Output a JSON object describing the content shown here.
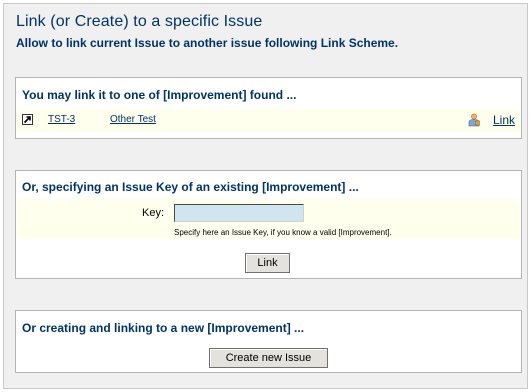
{
  "header": {
    "title": "Link (or Create) to a specific Issue",
    "subtitle": "Allow to link current Issue to another issue following Link Scheme."
  },
  "found_section": {
    "heading": "You may link it to one of [Improvement] found ...",
    "rows": [
      {
        "icon": "improvement-icon",
        "key": "TST-3",
        "summary": "Other Test",
        "assignee_icon": "person-icon",
        "action": "Link"
      }
    ]
  },
  "key_section": {
    "heading": "Or, specifying an Issue Key of an existing [Improvement] ...",
    "key_label": "Key:",
    "key_value": "",
    "hint": "Specify here an Issue Key, if you know a valid [Improvement].",
    "button": "Link"
  },
  "create_section": {
    "heading": "Or creating and linking to a new [Improvement] ...",
    "button": "Create new Issue"
  },
  "colors": {
    "heading_text": "#003366",
    "row_background": "#ffffee",
    "input_background": "#cfe6ef",
    "page_background": "#f0f0f0"
  }
}
